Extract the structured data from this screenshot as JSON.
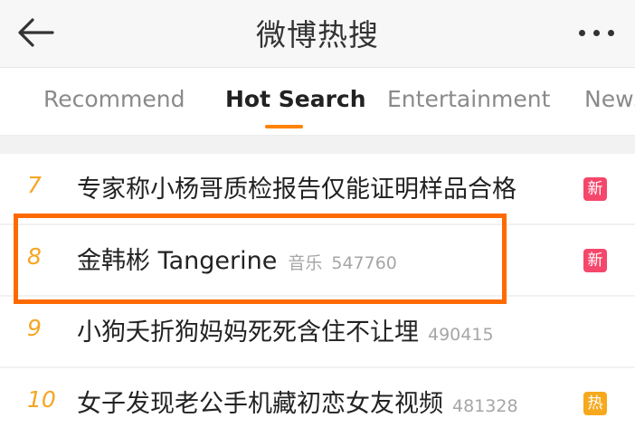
{
  "header": {
    "title": "微博热搜",
    "back_icon": "back-arrow-icon",
    "more_icon": "more-dots-icon"
  },
  "tabs": [
    {
      "label": "Recommend",
      "active": false
    },
    {
      "label": "Hot Search",
      "active": true
    },
    {
      "label": "Entertainment",
      "active": false
    },
    {
      "label": "News",
      "active": false
    }
  ],
  "accent_color": "#ff8200",
  "highlight_color": "#ff6a00",
  "list": [
    {
      "rank": "7",
      "title": "专家称小杨哥质检报告仅能证明样品合格",
      "category": "",
      "count": "",
      "badge": "新",
      "badge_color": "#f5476b"
    },
    {
      "rank": "8",
      "title": "金韩彬 Tangerine",
      "category": "音乐",
      "count": "547760",
      "badge": "新",
      "badge_color": "#f5476b",
      "highlighted": true
    },
    {
      "rank": "9",
      "title": "小狗夭折狗妈妈死死含住不让埋",
      "category": "",
      "count": "490415",
      "badge": "",
      "badge_color": ""
    },
    {
      "rank": "10",
      "title": "女子发现老公手机藏初恋女友视频",
      "category": "",
      "count": "481328",
      "badge": "热",
      "badge_color": "#f7a91e"
    }
  ]
}
